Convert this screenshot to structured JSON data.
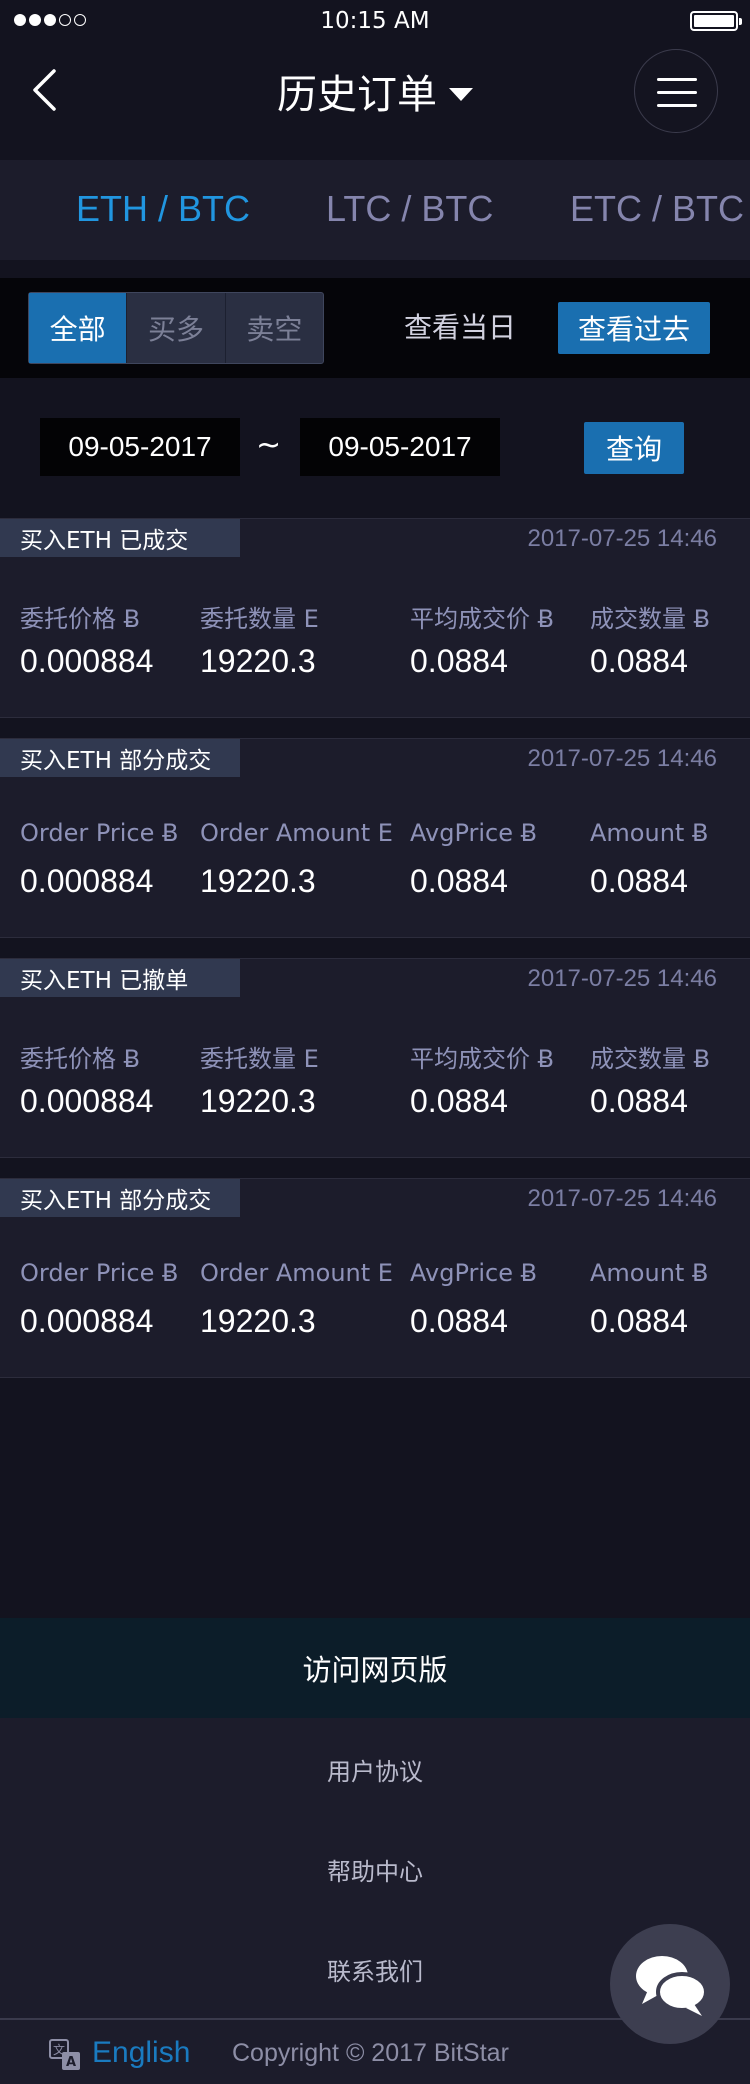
{
  "status": {
    "time": "10:15 AM"
  },
  "header": {
    "title": "历史订单"
  },
  "pairs": [
    "ETH / BTC",
    "LTC / BTC",
    "ETC / BTC"
  ],
  "filter": {
    "segments": [
      "全部",
      "买多",
      "卖空"
    ],
    "view_today": "查看当日",
    "view_past": "查看过去"
  },
  "date_range": {
    "start": "09-05-2017",
    "separator": "~",
    "end": "09-05-2017",
    "query_label": "查询"
  },
  "orders": [
    {
      "tag": "买入ETH   已成交",
      "time": "2017-07-25  14:46",
      "labels": [
        "委托价格 Ƀ",
        "委托数量 E",
        "平均成交价 Ƀ",
        "成交数量 Ƀ"
      ],
      "values": [
        "0.000884",
        "19220.3",
        "0.0884",
        "0.0884"
      ]
    },
    {
      "tag": "买入ETH   部分成交",
      "time": "2017-07-25  14:46",
      "labels": [
        "Order Price Ƀ",
        "Order Amount E",
        "AvgPrice Ƀ",
        "Amount Ƀ"
      ],
      "values": [
        "0.000884",
        "19220.3",
        "0.0884",
        "0.0884"
      ]
    },
    {
      "tag": "买入ETH   已撤单",
      "time": "2017-07-25  14:46",
      "labels": [
        "委托价格 Ƀ",
        "委托数量 E",
        "平均成交价 Ƀ",
        "成交数量 Ƀ"
      ],
      "values": [
        "0.000884",
        "19220.3",
        "0.0884",
        "0.0884"
      ]
    },
    {
      "tag": "买入ETH   部分成交",
      "time": "2017-07-25  14:46",
      "labels": [
        "Order Price Ƀ",
        "Order Amount E",
        "AvgPrice Ƀ",
        "Amount Ƀ"
      ],
      "values": [
        "0.000884",
        "19220.3",
        "0.0884",
        "0.0884"
      ]
    }
  ],
  "footer": {
    "visit_web": "访问网页版",
    "links": [
      "用户协议",
      "帮助中心",
      "联系我们"
    ],
    "language": "English",
    "copyright": "Copyright © 2017 BitStar"
  },
  "icons": {
    "back": "chevron-left-icon",
    "menu": "hamburger-menu-icon",
    "language": "translate-icon",
    "chat": "chat-bubbles-icon"
  },
  "colors": {
    "background": "#13131f",
    "card": "#1c1c2b",
    "accent": "#1a6fb0",
    "active_tab": "#2196e0",
    "label": "#8e92b8"
  }
}
